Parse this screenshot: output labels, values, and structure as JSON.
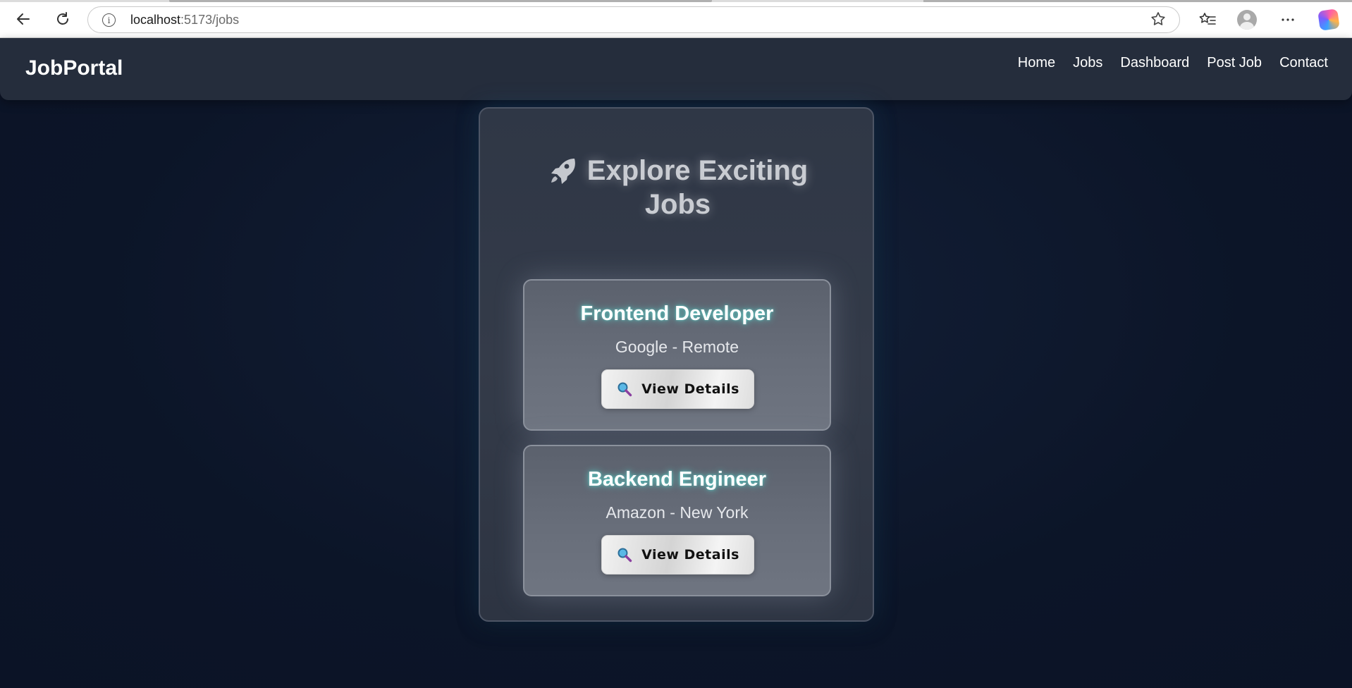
{
  "browser": {
    "url_host": "localhost",
    "url_path": ":5173/jobs",
    "icons": [
      "back-arrow-icon",
      "reload-icon",
      "site-info-icon",
      "star-icon",
      "favorites-icon",
      "profile-icon",
      "more-icon",
      "copilot-icon"
    ]
  },
  "app": {
    "brand": "JobPortal",
    "nav": [
      "Home",
      "Jobs",
      "Dashboard",
      "Post Job",
      "Contact"
    ]
  },
  "panel": {
    "icon": "rocket-icon",
    "title_line1": "Explore Exciting",
    "title_line2": "Jobs"
  },
  "jobs": [
    {
      "title": "Frontend Developer",
      "meta": "Google - Remote",
      "button": "View Details",
      "button_icon": "magnifier-icon"
    },
    {
      "title": "Backend Engineer",
      "meta": "Amazon - New York",
      "button": "View Details",
      "button_icon": "magnifier-icon"
    }
  ],
  "colors": {
    "page_bg": "#0d1526",
    "nav_bg": "#252d3c",
    "panel_bg": "#343b49",
    "card_bg": "#686e7a",
    "title_glow": "#5adcd2"
  }
}
